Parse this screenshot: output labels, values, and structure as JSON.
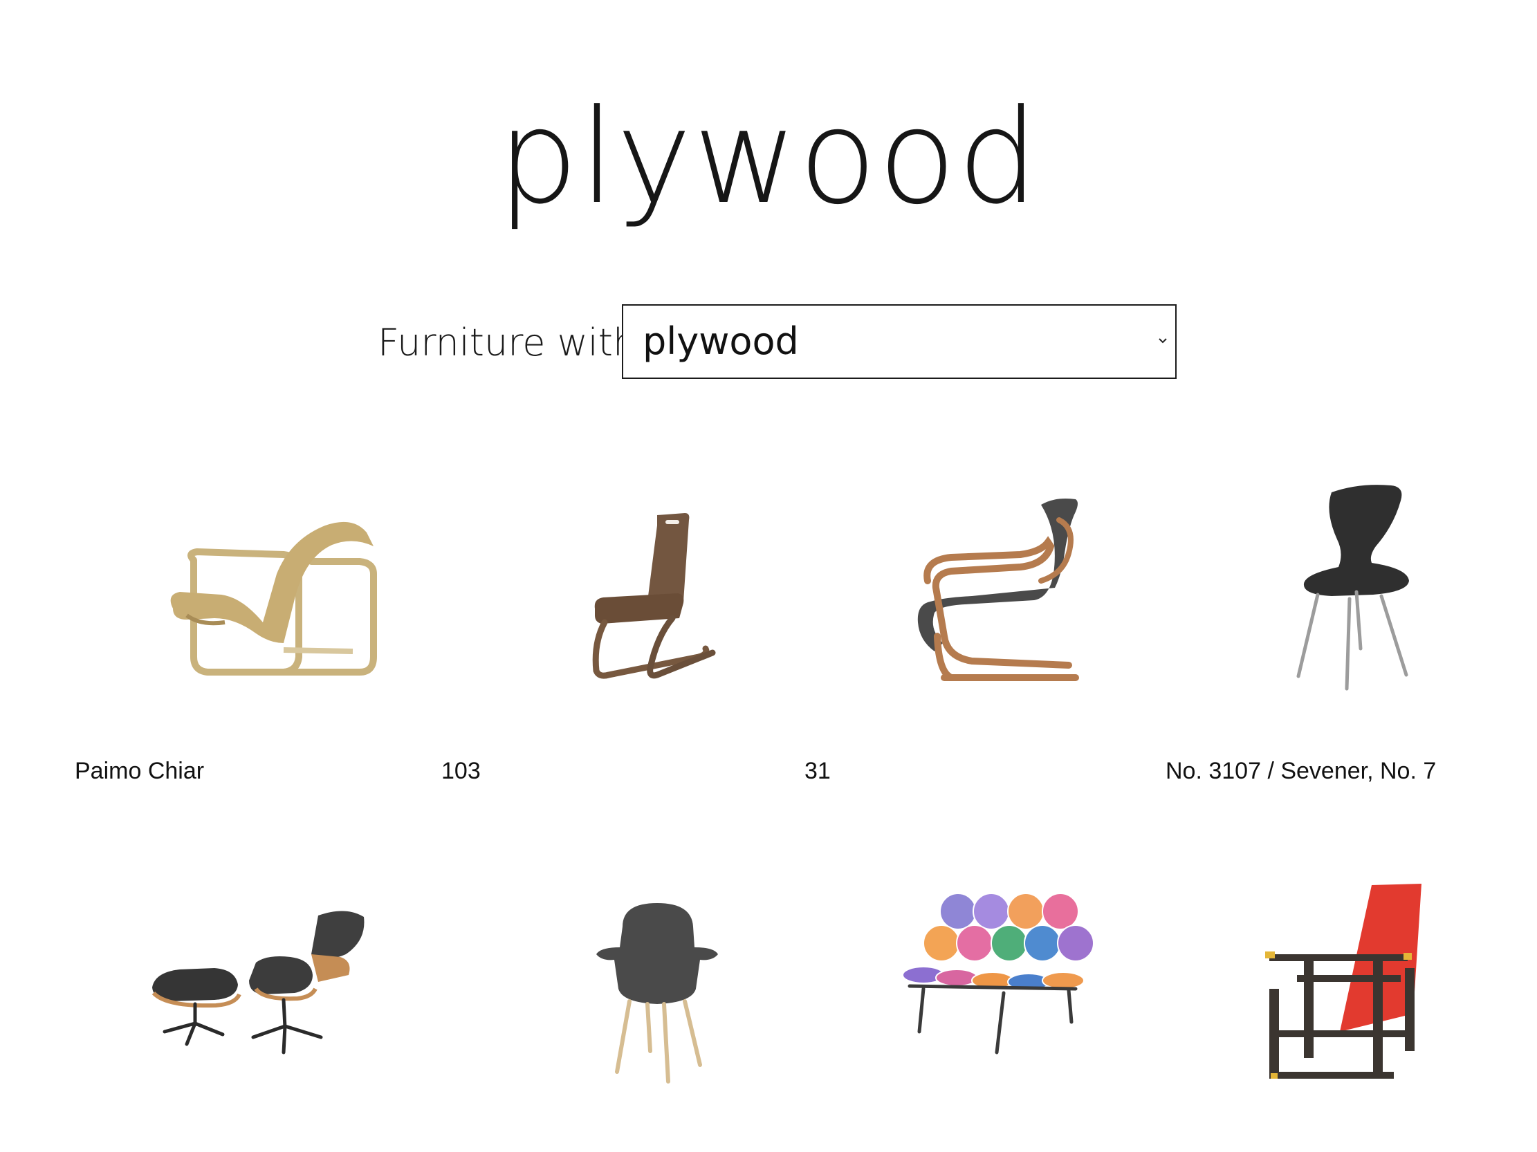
{
  "page": {
    "title": "plywood"
  },
  "filter": {
    "label": "Furniture with",
    "selected": "plywood"
  },
  "items": [
    {
      "title": "Paimo Chiar",
      "icon": "paimio-chair-image"
    },
    {
      "title": "103",
      "icon": "cantilever-chair-image"
    },
    {
      "title": "31",
      "icon": "armchair-31-image"
    },
    {
      "title": "No. 3107 / Sevener, No. 7",
      "icon": "series-7-chair-image"
    },
    {
      "title": "",
      "icon": "lounge-chair-ottoman-image"
    },
    {
      "title": "",
      "icon": "organic-chair-image"
    },
    {
      "title": "",
      "icon": "marshmallow-sofa-image"
    },
    {
      "title": "",
      "icon": "red-blue-chair-image"
    }
  ]
}
